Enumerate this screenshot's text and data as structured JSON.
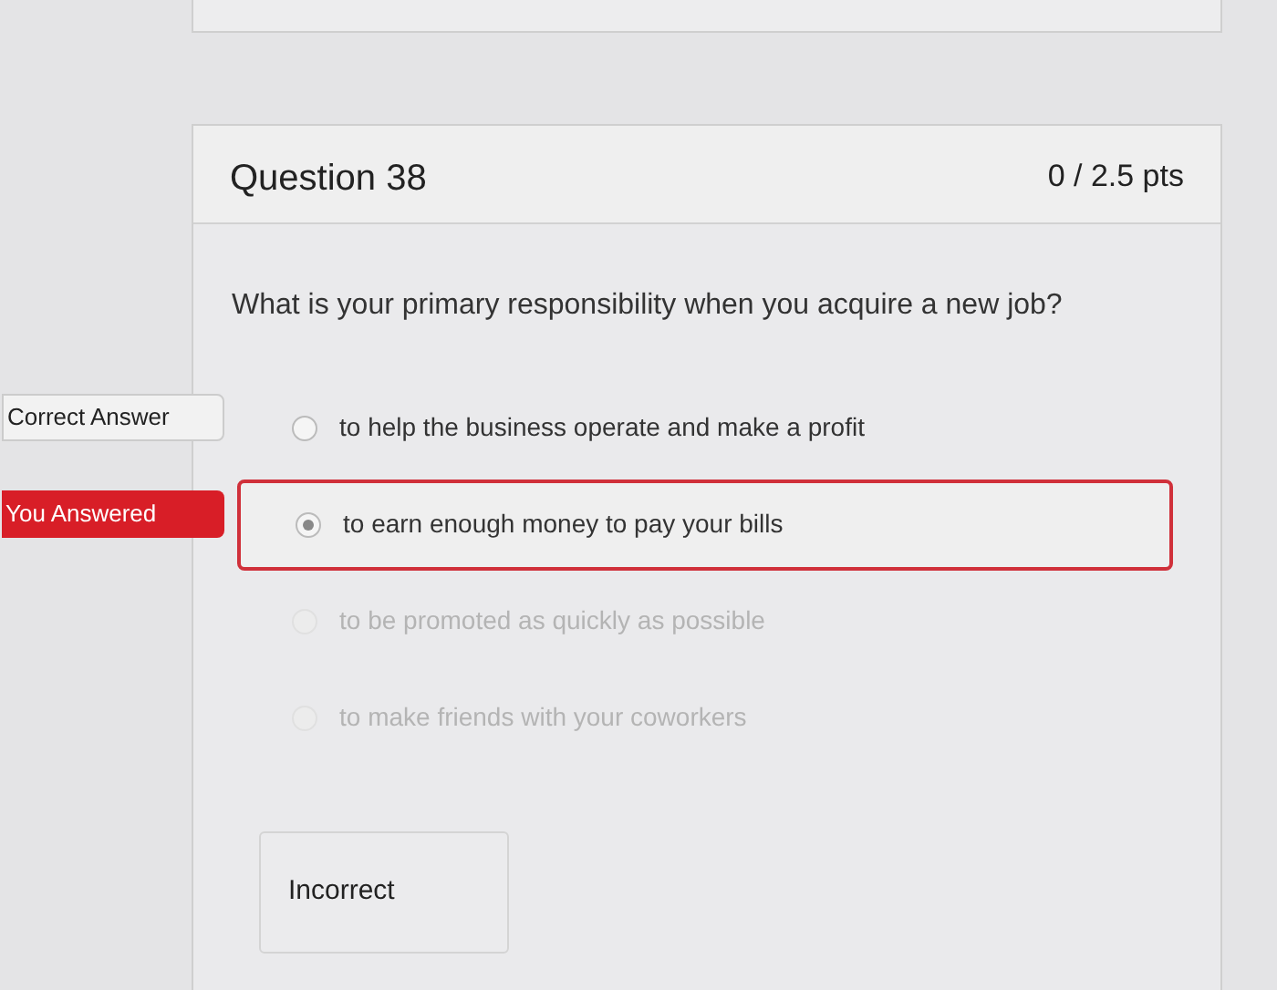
{
  "question": {
    "title": "Question 38",
    "points": "0 / 2.5 pts",
    "text": "What is your primary responsibility when you acquire a new job?",
    "answers": [
      {
        "text": "to help the business operate and make a profit",
        "selected": false,
        "disabled": false,
        "marker": {
          "kind": "correct",
          "label": "Correct Answer"
        }
      },
      {
        "text": "to earn enough money to pay your bills",
        "selected": true,
        "disabled": false,
        "marker": {
          "kind": "wrong",
          "label": "You Answered"
        }
      },
      {
        "text": "to be promoted as quickly as possible",
        "selected": false,
        "disabled": true
      },
      {
        "text": "to make friends with your coworkers",
        "selected": false,
        "disabled": true
      }
    ],
    "result": "Incorrect"
  }
}
